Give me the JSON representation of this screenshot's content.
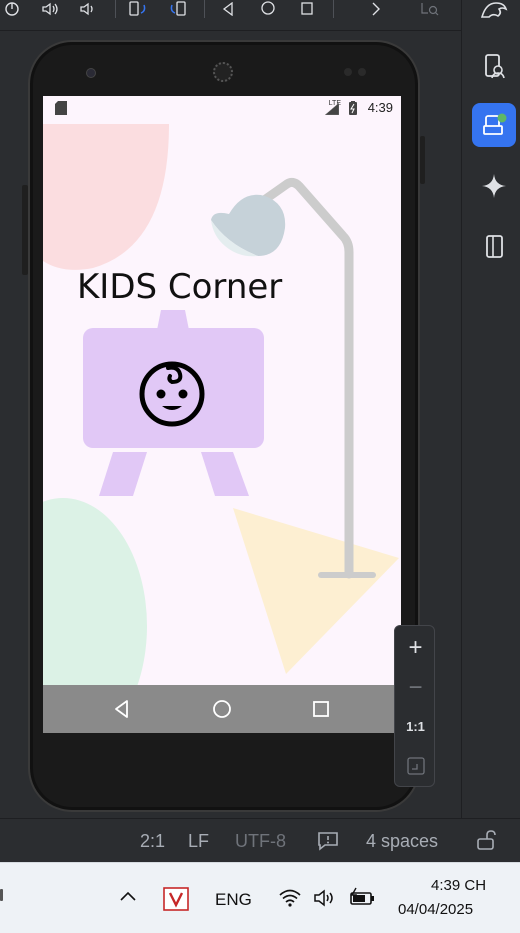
{
  "toolbar": {
    "icons": [
      "power-icon",
      "volume-up-icon",
      "volume-down-icon",
      "rotate-left-icon",
      "rotate-right-icon",
      "back-icon",
      "home-icon",
      "overview-icon",
      "more-icon",
      "zoom-icon"
    ]
  },
  "right_strip": {
    "items": [
      "gemini-icon",
      "device-manager-icon",
      "running-devices-icon",
      "ai-sparkle-icon",
      "device-mirroring-icon"
    ]
  },
  "device": {
    "status_time": "4:39",
    "network": "LTE",
    "app": {
      "title": "KIDS Corner"
    }
  },
  "zoom": {
    "zoom_in": "+",
    "zoom_out": "−",
    "actual_size": "1:1"
  },
  "ide_status": {
    "position": "2:1",
    "line_ending": "LF",
    "encoding": "UTF-8",
    "indent": "4 spaces"
  },
  "taskbar": {
    "language": "ENG",
    "time": "4:39 CH",
    "date": "04/04/2025"
  },
  "colors": {
    "accent": "#3574f0",
    "screen_bg": "#fdf5fd",
    "tv_purple": "#e1c8f6"
  }
}
